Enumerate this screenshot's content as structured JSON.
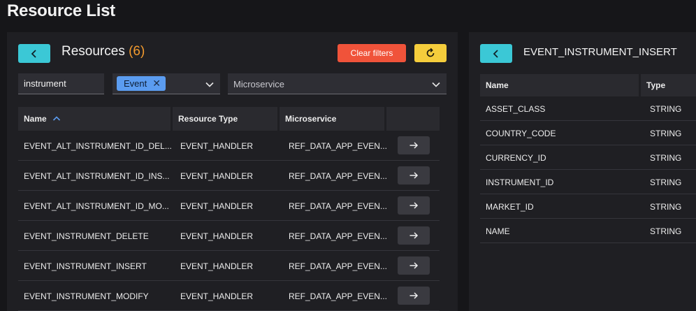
{
  "page": {
    "title": "Resource List"
  },
  "resources": {
    "heading": "Resources",
    "count_display": "(6)",
    "clear_filters_label": "Clear filters",
    "search": {
      "value": "instrument"
    },
    "type_filter": {
      "chip": "Event"
    },
    "microservice_filter": {
      "placeholder": "Microservice"
    },
    "columns": {
      "name": "Name",
      "type": "Resource Type",
      "microservice": "Microservice"
    },
    "rows": [
      {
        "name": "EVENT_ALT_INSTRUMENT_ID_DEL...",
        "type": "EVENT_HANDLER",
        "microservice": "REF_DATA_APP_EVEN..."
      },
      {
        "name": "EVENT_ALT_INSTRUMENT_ID_INS...",
        "type": "EVENT_HANDLER",
        "microservice": "REF_DATA_APP_EVEN..."
      },
      {
        "name": "EVENT_ALT_INSTRUMENT_ID_MO...",
        "type": "EVENT_HANDLER",
        "microservice": "REF_DATA_APP_EVEN..."
      },
      {
        "name": "EVENT_INSTRUMENT_DELETE",
        "type": "EVENT_HANDLER",
        "microservice": "REF_DATA_APP_EVEN..."
      },
      {
        "name": "EVENT_INSTRUMENT_INSERT",
        "type": "EVENT_HANDLER",
        "microservice": "REF_DATA_APP_EVEN..."
      },
      {
        "name": "EVENT_INSTRUMENT_MODIFY",
        "type": "EVENT_HANDLER",
        "microservice": "REF_DATA_APP_EVEN..."
      }
    ]
  },
  "detail": {
    "title": "EVENT_INSTRUMENT_INSERT",
    "columns": {
      "name": "Name",
      "type": "Type"
    },
    "fields": [
      {
        "name": "ASSET_CLASS",
        "type": "STRING"
      },
      {
        "name": "COUNTRY_CODE",
        "type": "STRING"
      },
      {
        "name": "CURRENCY_ID",
        "type": "STRING"
      },
      {
        "name": "INSTRUMENT_ID",
        "type": "STRING"
      },
      {
        "name": "MARKET_ID",
        "type": "STRING"
      },
      {
        "name": "NAME",
        "type": "STRING"
      }
    ]
  },
  "icons": {
    "back": "chevron-left-icon",
    "refresh": "refresh-icon",
    "sort": "sort-ascending-icon",
    "dropdown": "chevron-down-icon",
    "remove": "close-icon",
    "navigate": "arrow-right-icon"
  },
  "colors": {
    "background": "#161619",
    "panel": "#1f1f23",
    "back_button": "#3bc8d6",
    "clear_button": "#f0533a",
    "refresh_button": "#f5cd3c",
    "chip": "#5b9cf0",
    "count": "#f29a2e"
  }
}
